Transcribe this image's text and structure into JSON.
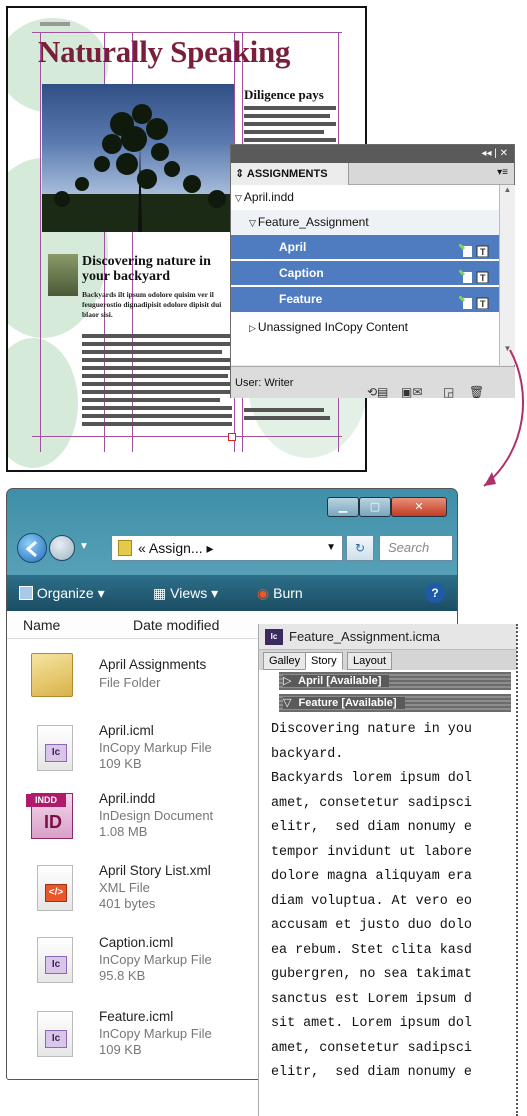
{
  "layout": {
    "masthead": "Naturally Speaking",
    "sidebar_heading": "Diligence pays",
    "subhead": "Discovering nature in your backyard",
    "subtext": "Backyards ilt ipsum odolore quisim ver il feuguerostio dignadipisit odolore dipisit dui blaor sisi."
  },
  "assignments_panel": {
    "tab_label": "ASSIGNMENTS",
    "tree": [
      {
        "label": "April.indd",
        "level": 0,
        "expanded": true,
        "selected": false
      },
      {
        "label": "Feature_Assignment",
        "level": 1,
        "expanded": true,
        "selected": false
      },
      {
        "label": "April",
        "level": 2,
        "selected": true
      },
      {
        "label": "Caption",
        "level": 2,
        "selected": true
      },
      {
        "label": "Feature",
        "level": 2,
        "selected": true
      },
      {
        "label": "Unassigned InCopy Content",
        "level": 1,
        "expanded": false,
        "selected": false
      }
    ],
    "user_label": "User: Writer",
    "accent_color": "#4f7cc1"
  },
  "explorer": {
    "address": "« Assign... ▸",
    "search_placeholder": "Search",
    "toolbar": {
      "organize": "Organize",
      "views": "Views",
      "burn": "Burn"
    },
    "columns": {
      "name": "Name",
      "date_modified": "Date modified"
    },
    "files": [
      {
        "name": "April Assignments",
        "type": "File Folder",
        "size": "",
        "icon": "folder-icon"
      },
      {
        "name": "April.icml",
        "type": "InCopy Markup File",
        "size": "109 KB",
        "icon": "incopy-file-icon"
      },
      {
        "name": "April.indd",
        "type": "InDesign Document",
        "size": "1.08 MB",
        "icon": "indesign-file-icon"
      },
      {
        "name": "April Story List.xml",
        "type": "XML File",
        "size": "401 bytes",
        "icon": "xml-file-icon"
      },
      {
        "name": "Caption.icml",
        "type": "InCopy Markup File",
        "size": "95.8 KB",
        "icon": "incopy-file-icon"
      },
      {
        "name": "Feature.icml",
        "type": "InCopy Markup File",
        "size": "109 KB",
        "icon": "incopy-file-icon"
      }
    ]
  },
  "story_editor": {
    "title": "Feature_Assignment.icma",
    "tabs": [
      "Galley",
      "Story",
      "Layout"
    ],
    "active_tab": "Story",
    "story_bars": [
      "April [Available]",
      "Feature [Available]"
    ],
    "text_lines": [
      "Discovering nature in you",
      "backyard.",
      "Backyards lorem ipsum dol",
      "amet, consetetur sadipsci",
      "elitr,  sed diam nonumy e",
      "tempor invidunt ut labore",
      "dolore magna aliquyam era",
      "diam voluptua. At vero eo",
      "accusam et justo duo dolo",
      "ea rebum. Stet clita kasd",
      "gubergren, no sea takimat",
      "sanctus est Lorem ipsum d",
      "sit amet. Lorem ipsum dol",
      "amet, consetetur sadipsci",
      "elitr,  sed diam nonumy e"
    ]
  }
}
